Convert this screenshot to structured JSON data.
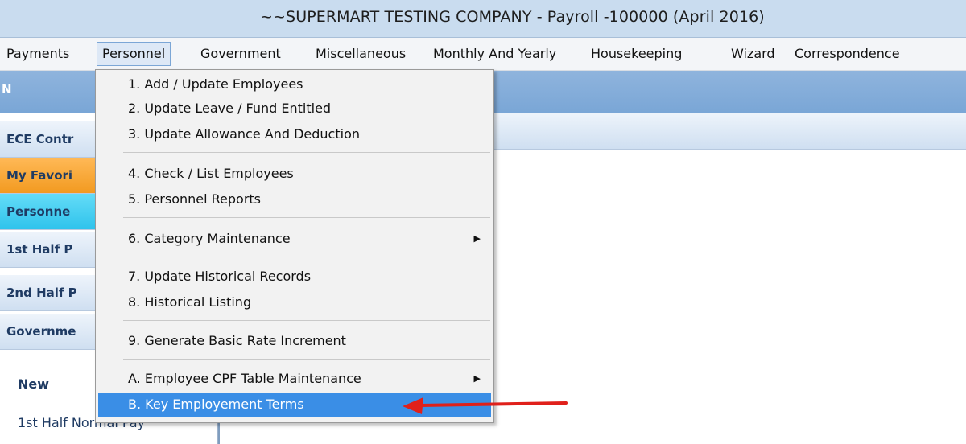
{
  "window": {
    "title": "~~SUPERMART TESTING COMPANY - Payroll -100000 (April 2016)"
  },
  "menubar": {
    "items": [
      "Payments",
      "Personnel",
      "Government",
      "Miscellaneous",
      "Monthly And Yearly",
      "Housekeeping",
      "Wizard",
      "Correspondence"
    ]
  },
  "header": {
    "partial_label": "N"
  },
  "sidebar": {
    "buttons": [
      "ECE Contr",
      "My Favori",
      "Personne",
      "1st Half P",
      "2nd Half P",
      "Governme"
    ],
    "section_label": "New",
    "sub_item": "1st Half Normal Pay"
  },
  "personnel_menu": {
    "items": [
      {
        "key": "1",
        "label": "1. Add / Update Employees"
      },
      {
        "key": "2",
        "label": "2. Update Leave / Fund Entitled"
      },
      {
        "key": "3",
        "label": "3. Update Allowance And Deduction"
      },
      {
        "key": "4",
        "label": "4. Check / List Employees"
      },
      {
        "key": "5",
        "label": "5. Personnel Reports"
      },
      {
        "key": "6",
        "label": "6. Category Maintenance",
        "submenu": true
      },
      {
        "key": "7",
        "label": "7. Update Historical Records"
      },
      {
        "key": "8",
        "label": "8. Historical Listing"
      },
      {
        "key": "9",
        "label": "9. Generate Basic Rate Increment"
      },
      {
        "key": "A",
        "label": "A. Employee CPF Table Maintenance",
        "submenu": true
      },
      {
        "key": "B",
        "label": "B. Key Employement Terms",
        "highlighted": true
      }
    ],
    "submenu_arrow": "▶"
  },
  "colors": {
    "highlight": "#3a8ee6",
    "annotation_arrow": "#e0201b",
    "favorite_tab": "#f29a20",
    "personnel_tab": "#2fc3ec"
  },
  "icons": {
    "annotation": "red-arrow-icon"
  }
}
